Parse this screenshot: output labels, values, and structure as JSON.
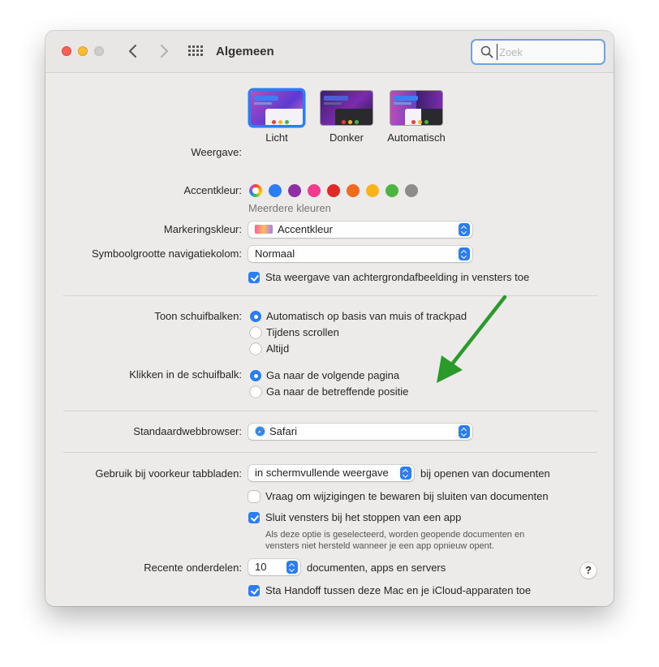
{
  "window": {
    "title": "Algemeen"
  },
  "search": {
    "placeholder": "Zoek",
    "value": ""
  },
  "appearance": {
    "label": "Weergave:",
    "options": [
      {
        "label": "Licht",
        "selected": true
      },
      {
        "label": "Donker",
        "selected": false
      },
      {
        "label": "Automatisch",
        "selected": false
      }
    ]
  },
  "accent": {
    "label": "Accentkleur:",
    "selected_caption": "Meerdere kleuren",
    "colors": [
      "#2a7df2",
      "#8e2fa6",
      "#f03b90",
      "#e02a2a",
      "#f26b1c",
      "#f9b41b",
      "#4cb541",
      "#8c8c8c"
    ]
  },
  "highlight": {
    "label": "Markeringskleur:",
    "value": "Accentkleur"
  },
  "sidebar_icon_size": {
    "label": "Symboolgrootte navigatiekolom:",
    "value": "Normaal"
  },
  "wallpaper_tinting": {
    "label": "Sta weergave van achtergrondafbeelding in vensters toe",
    "checked": true
  },
  "scrollbars": {
    "label": "Toon schuifbalken:",
    "options": [
      {
        "label": "Automatisch op basis van muis of trackpad",
        "selected": true
      },
      {
        "label": "Tijdens scrollen",
        "selected": false
      },
      {
        "label": "Altijd",
        "selected": false
      }
    ]
  },
  "click_scrollbar": {
    "label": "Klikken in de schuifbalk:",
    "options": [
      {
        "label": "Ga naar de volgende pagina",
        "selected": true
      },
      {
        "label": "Ga naar de betreffende positie",
        "selected": false
      }
    ]
  },
  "default_browser": {
    "label": "Standaardwebbrowser:",
    "value": "Safari"
  },
  "tabs": {
    "label": "Gebruik bij voorkeur tabbladen:",
    "value": "in schermvullende weergave",
    "suffix": "bij openen van documenten"
  },
  "ask_keep_changes": {
    "label": "Vraag om wijzigingen te bewaren bij sluiten van documenten",
    "checked": false
  },
  "close_windows": {
    "label": "Sluit vensters bij het stoppen van een app",
    "checked": true,
    "hint_line1": "Als deze optie is geselecteerd, worden geopende documenten en",
    "hint_line2": "vensters niet hersteld wanneer je een app opnieuw opent."
  },
  "recent_items": {
    "label": "Recente onderdelen:",
    "value": "10",
    "suffix": "documenten, apps en servers"
  },
  "handoff": {
    "label": "Sta Handoff tussen deze Mac en je iCloud-apparaten toe",
    "checked": true
  },
  "help": {
    "label": "?"
  },
  "annotation": {
    "arrow_color": "#2a9a2a"
  }
}
